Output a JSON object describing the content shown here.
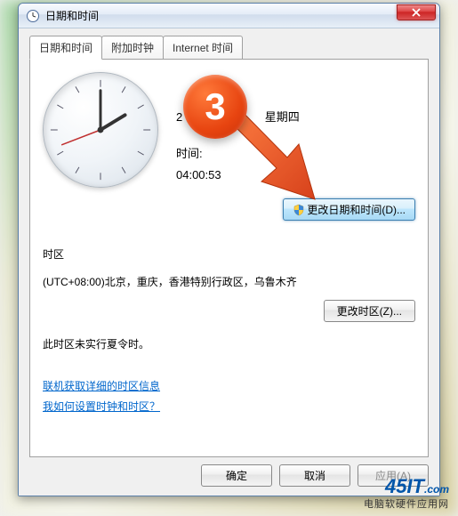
{
  "window": {
    "title": "日期和时间"
  },
  "tabs": [
    {
      "label": "日期和时间",
      "active": true
    },
    {
      "label": "附加时钟",
      "active": false
    },
    {
      "label": "Internet 时间",
      "active": false
    }
  ],
  "datetime": {
    "date": "2　　　10　　　星期四",
    "time_label": "时间:",
    "time_value": "04:00:53",
    "change_button": "更改日期和时间(D)..."
  },
  "timezone": {
    "label": "时区",
    "name": "(UTC+08:00)北京，重庆，香港特别行政区，乌鲁木齐",
    "change_button": "更改时区(Z)...",
    "dst_note": "此时区未实行夏令时。"
  },
  "links": {
    "online_info": "联机获取详细的时区信息",
    "how_to": "我如何设置时钟和时区？"
  },
  "buttons": {
    "ok": "确定",
    "cancel": "取消",
    "apply": "应用(A)"
  },
  "annotation": {
    "step": "3"
  },
  "watermark": {
    "logo": "45IT",
    "dotcom": ".com",
    "sub": "电脑软硬件应用网"
  }
}
